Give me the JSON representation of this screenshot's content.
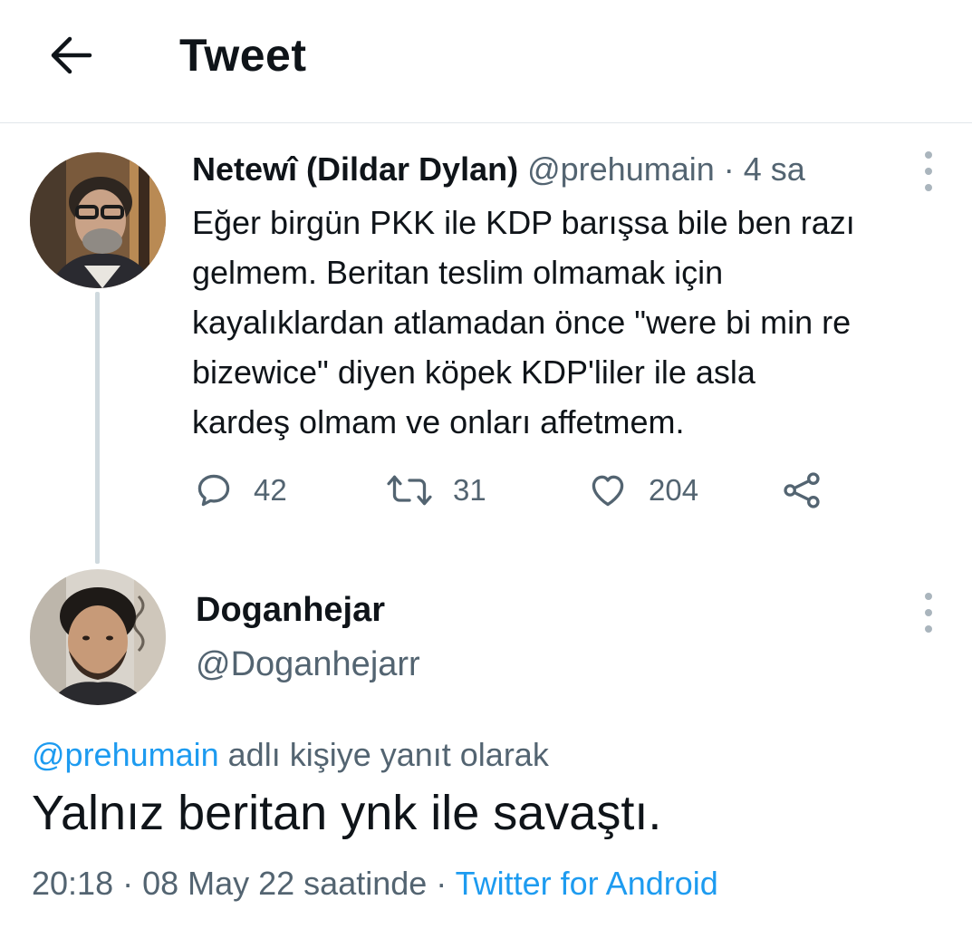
{
  "header": {
    "title": "Tweet"
  },
  "parent_tweet": {
    "display_name": "Netewî (Dildar Dylan)",
    "handle": "@prehumain",
    "separator": " · ",
    "time_ago": "4 sa",
    "text_lines": [
      "Eğer birgün PKK ile KDP barışsa bile ben razı",
      "gelmem. Beritan teslim olmamak için",
      "kayalıklardan atlamadan önce \"were bi min re",
      "bizewice\" diyen köpek KDP'liler ile asla",
      "kardeş olmam ve onları affetmem."
    ],
    "replies": "42",
    "retweets": "31",
    "likes": "204"
  },
  "reply_tweet": {
    "display_name": "Doganhejar",
    "handle": "@Doganhejarr",
    "replying_handle": "@prehumain",
    "replying_suffix": " adlı kişiye yanıt olarak",
    "text": "Yalnız beritan ynk ile savaştı.",
    "timestamp": "20:18 · 08 May 22 saatinde · ",
    "source": "Twitter for Android"
  },
  "colors": {
    "link": "#1d9bf0",
    "muted": "#536471",
    "text": "#0f1419",
    "divider": "#e1e6ea"
  }
}
